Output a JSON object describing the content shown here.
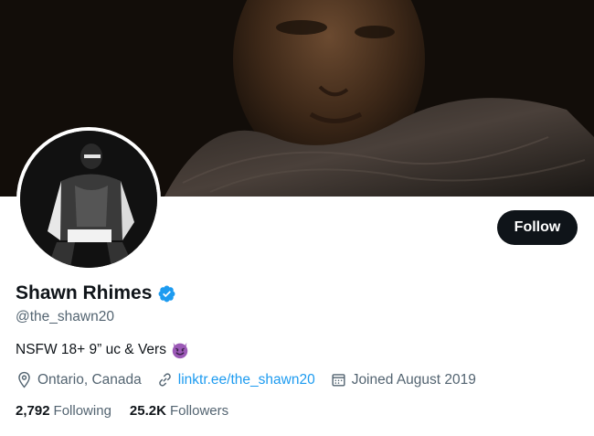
{
  "profile": {
    "display_name": "Shawn Rhimes",
    "handle": "@the_shawn20",
    "bio": "NSFW 18+ 9” uc & Vers",
    "bio_emoji": "smiling-devil-icon",
    "location": "Ontario, Canada",
    "website": "linktr.ee/the_shawn20",
    "joined": "Joined August 2019",
    "following_count": "2,792",
    "following_label": "Following",
    "followers_count": "25.2K",
    "followers_label": "Followers",
    "verified_color": "#1d9bf0"
  },
  "actions": {
    "follow_label": "Follow"
  },
  "colors": {
    "primary_text": "#0f1419",
    "secondary_text": "#536471",
    "accent": "#1d9bf0",
    "follow_bg": "#0f1419"
  }
}
